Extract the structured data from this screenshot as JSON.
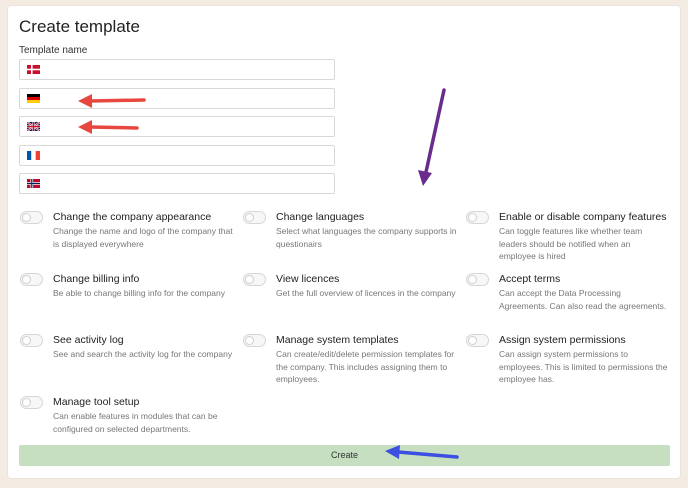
{
  "title": "Create template",
  "template_name_label": "Template name",
  "languages": [
    {
      "flag": "denmark-flag-icon",
      "value": ""
    },
    {
      "flag": "germany-flag-icon",
      "value": ""
    },
    {
      "flag": "uk-flag-icon",
      "value": ""
    },
    {
      "flag": "france-flag-icon",
      "value": ""
    },
    {
      "flag": "norway-flag-icon",
      "value": ""
    }
  ],
  "permissions": [
    {
      "title": "Change the company appearance",
      "desc": "Change the name and logo of the company that is displayed everywhere"
    },
    {
      "title": "Change languages",
      "desc": "Select what languages the company supports in questionairs"
    },
    {
      "title": "Enable or disable company features",
      "desc": "Can toggle features like whether team leaders should be notified when an employee is hired"
    },
    {
      "title": "Change billing info",
      "desc": "Be able to change billing info for the company"
    },
    {
      "title": "View licences",
      "desc": "Get the full overview of licences in the company"
    },
    {
      "title": "Accept terms",
      "desc": "Can accept the Data Processing Agreements. Can also read the agreements."
    },
    {
      "title": "See activity log",
      "desc": "See and search the activity log for the company"
    },
    {
      "title": "Manage system templates",
      "desc": "Can create/edit/delete permission templates for the company. This includes assigning them to employees."
    },
    {
      "title": "Assign system permissions",
      "desc": "Can assign system permissions to employees. This is limited to permissions the employee has."
    },
    {
      "title": "Manage tool setup",
      "desc": "Can enable features in modules that can be configured on selected departments."
    }
  ],
  "create_label": "Create",
  "colors": {
    "create_button": "#c6dfc0",
    "red_arrow": "#e8473f",
    "purple_arrow": "#6a2c8c",
    "blue_arrow": "#3d4fe0"
  }
}
